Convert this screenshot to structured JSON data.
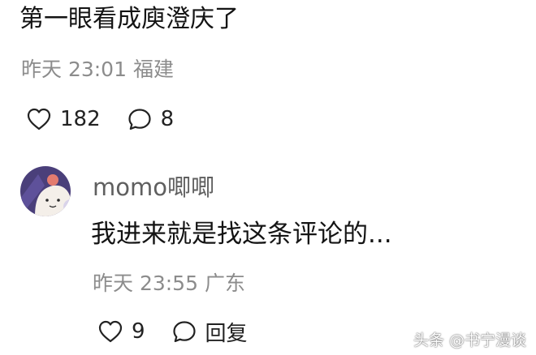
{
  "comment": {
    "text": "第一眼看成庾澄庆了",
    "meta": "昨天 23:01 福建",
    "likes": "182",
    "replies": "8"
  },
  "reply": {
    "username": "momo唧唧",
    "text": "我进来就是找这条评论的...",
    "meta": "昨天 23:55 广东",
    "likes": "9",
    "reply_label": "回复"
  },
  "watermark": "头条 @书宁漫谈",
  "icons": {
    "like": "heart-outline-icon",
    "comment": "speech-bubble-icon"
  },
  "colors": {
    "text": "#141414",
    "meta": "#8c8c8c",
    "username": "#5f5f5f",
    "avatar_bg": "#4a3f7a",
    "avatar_face": "#f4efe9",
    "avatar_accent": "#e37b6f"
  }
}
